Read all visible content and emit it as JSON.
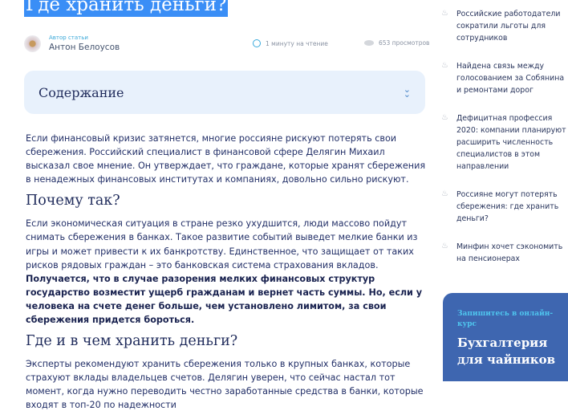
{
  "article": {
    "title": "Где хранить деньги?",
    "author_label": "Автор статьи",
    "author_name": "Антон Белоусов",
    "read_time": "1 минуту на чтение",
    "views": "653 просмотров"
  },
  "toc": {
    "label": "Содержание"
  },
  "body": {
    "p1": "Если финансовый кризис затянется, многие россияне рискуют потерять свои сбережения. Российский специалист в финансовой сфере Делягин Михаил высказал свое мнение. Он утверждает, что граждане, которые хранят сбережения в ненадежных финансовых институтах и компаниях, довольно сильно рискуют.",
    "h1": "Почему так?",
    "p2": "Если экономическая ситуация в стране резко ухудшится, люди массово пойдут снимать сбережения в банках. Такое развитие событий выведет мелкие банки из игры и может привести к их банкротству. Единственное, что защищает от таких рисков рядовых граждан – это банковская система страхования вкладов. ",
    "p2_bold": "Получается, что в случае разорения мелких финансовых структур государство возместит ущерб гражданам и вернет часть суммы. Но, если у человека на счете денег больше, чем установлено лимитом, за свои сбережения придется бороться.",
    "h2": "Где и в чем хранить деньги?",
    "p3": "Эксперты рекомендуют хранить сбережения только в крупных банках, которые страхуют вклады владельцев счетов. Делягин уверен, что сейчас настал тот момент, когда нужно переводить честно заработанные средства в банки, которые входят в топ-20 по надежности"
  },
  "sidebar": {
    "news": [
      "Российские работодатели сократили льготы для сотрудников",
      "Найдена связь между голосованием за Собянина и ремонтами дорог",
      "Дефицитная профессия 2020: компании планируют расширить численность специалистов в этом направлении",
      "Россияне могут потерять сбережения: где хранить деньги?",
      "Минфин хочет сэкономить на пенсионерах"
    ],
    "promo": {
      "subtitle": "Запишитесь в онлайн-курс",
      "title": "Бухгалтерия для чайников"
    }
  }
}
